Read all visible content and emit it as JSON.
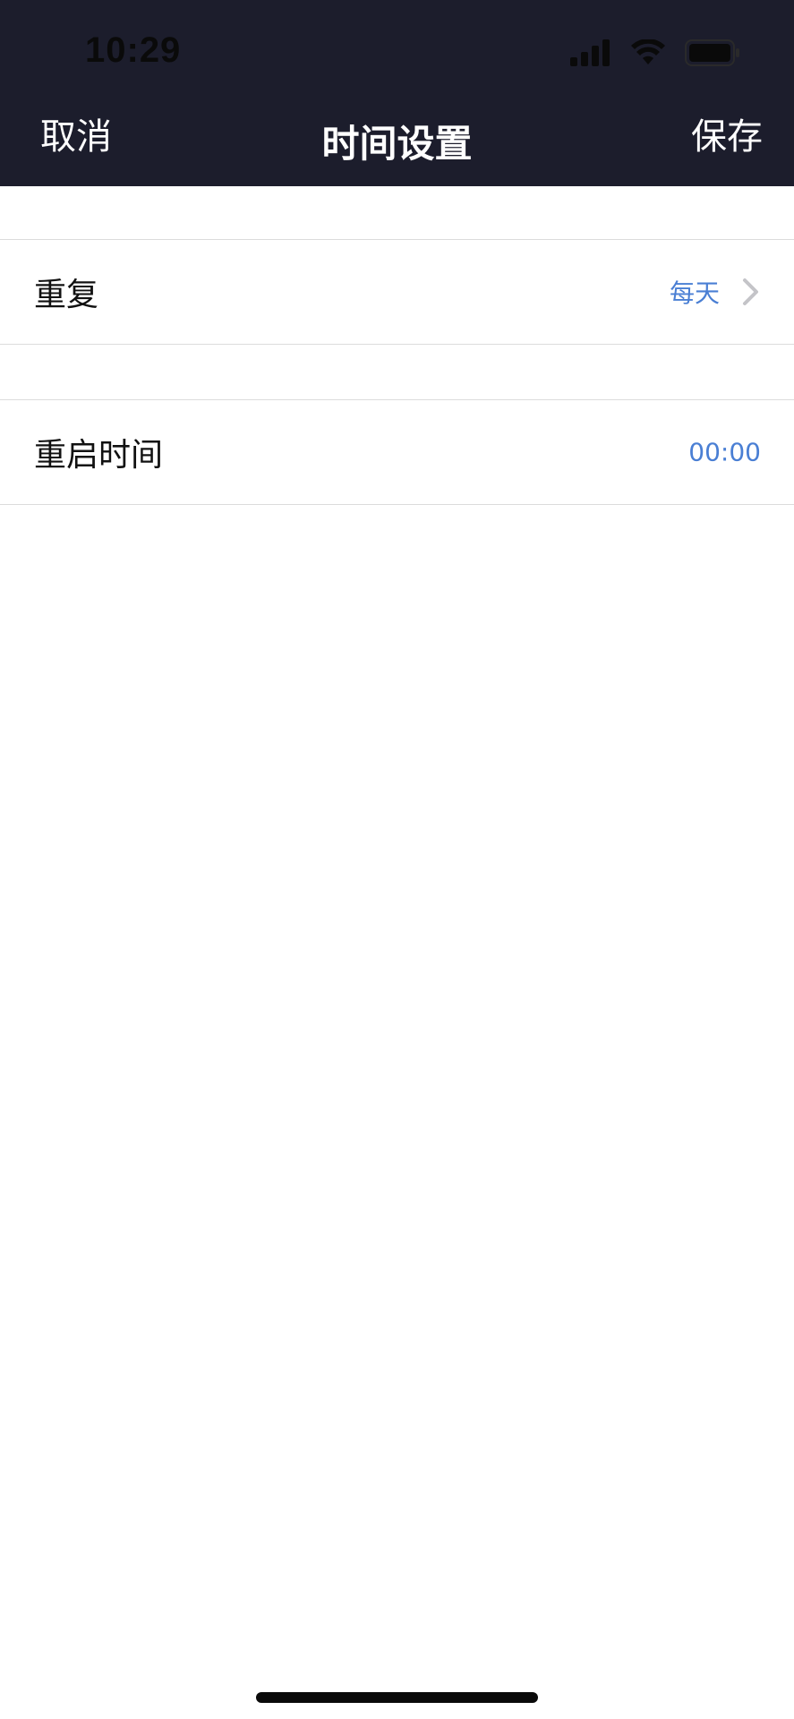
{
  "status_bar": {
    "time": "10:29"
  },
  "nav": {
    "cancel_label": "取消",
    "title": "时间设置",
    "save_label": "保存"
  },
  "rows": [
    {
      "label": "重复",
      "value": "每天"
    },
    {
      "label": "重启时间",
      "value": "00:00"
    }
  ],
  "colors": {
    "header_bg": "#1c1d2c",
    "value_blue": "#4a7fd4",
    "divider": "#dcdcdc"
  }
}
